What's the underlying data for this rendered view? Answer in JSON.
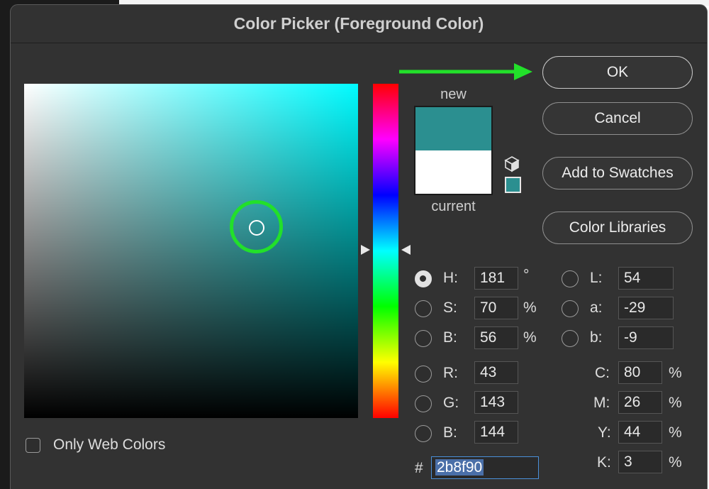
{
  "dialog": {
    "title": "Color Picker (Foreground Color)"
  },
  "swatch": {
    "new_label": "new",
    "current_label": "current",
    "new_color": "#2b8f90",
    "current_color": "#ffffff"
  },
  "buttons": {
    "ok": "OK",
    "cancel": "Cancel",
    "add_to_swatches": "Add to Swatches",
    "color_libraries": "Color Libraries"
  },
  "hsb": {
    "h": {
      "label": "H:",
      "value": "181",
      "unit": "°",
      "selected": true
    },
    "s": {
      "label": "S:",
      "value": "70",
      "unit": "%"
    },
    "b": {
      "label": "B:",
      "value": "56",
      "unit": "%"
    }
  },
  "lab": {
    "l": {
      "label": "L:",
      "value": "54"
    },
    "a": {
      "label": "a:",
      "value": "-29"
    },
    "b": {
      "label": "b:",
      "value": "-9"
    }
  },
  "rgb": {
    "r": {
      "label": "R:",
      "value": "43"
    },
    "g": {
      "label": "G:",
      "value": "143"
    },
    "b": {
      "label": "B:",
      "value": "144"
    }
  },
  "cmyk": {
    "c": {
      "label": "C:",
      "value": "80",
      "unit": "%"
    },
    "m": {
      "label": "M:",
      "value": "26",
      "unit": "%"
    },
    "y": {
      "label": "Y:",
      "value": "44",
      "unit": "%"
    },
    "k": {
      "label": "K:",
      "value": "3",
      "unit": "%"
    }
  },
  "hex": {
    "label": "#",
    "value": "2b8f90"
  },
  "web_colors": {
    "label": "Only Web Colors",
    "checked": false
  },
  "colors": {
    "annotation_green": "#22e02a",
    "dialog_bg": "#323232"
  }
}
